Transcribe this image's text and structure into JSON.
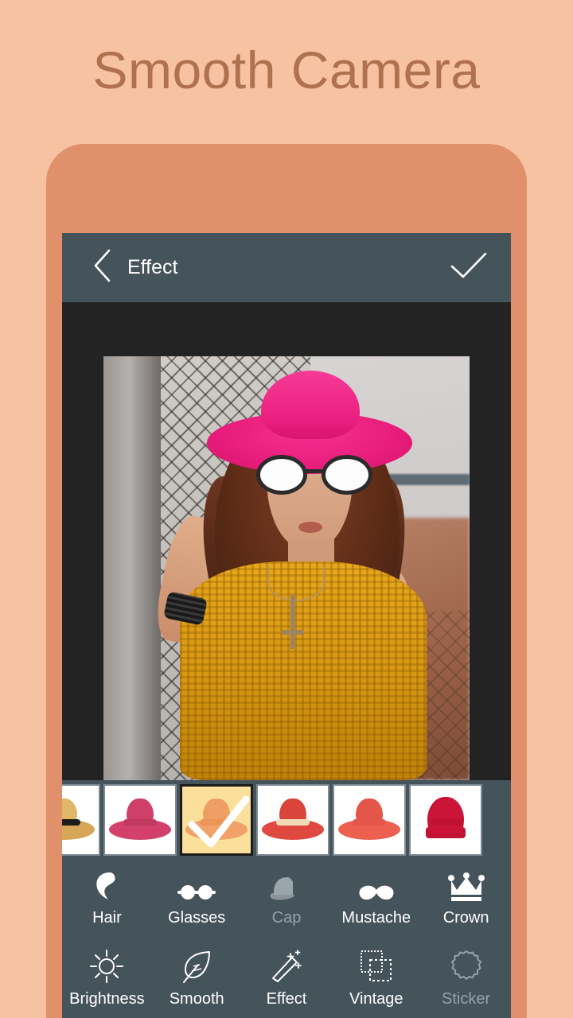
{
  "promo": {
    "title": "Smooth Camera"
  },
  "theme": {
    "background": "#f7c2a2",
    "phone_frame": "#e0916b",
    "title_color": "#b0714f",
    "bar_color": "#45535b",
    "canvas_color": "#232323",
    "selected_thumb_bg": "#fbe09b",
    "dim_text": "#98a3a9"
  },
  "appbar": {
    "back_icon": "chevron-left-icon",
    "title": "Effect",
    "done_icon": "checkmark-icon"
  },
  "photo": {
    "subject_description": "Woman in yellow knit sweater by chain-link fence",
    "overlay_hat": "pink floppy hat",
    "overlay_glasses": "white lens round glasses"
  },
  "thumbnails": [
    {
      "name": "straw-fedora",
      "selected": false,
      "brim": "#d6a758",
      "crown": "#e0b768",
      "band": "#1d1d1d"
    },
    {
      "name": "pink-bucket-hat",
      "selected": false,
      "brim": "#d3416b",
      "crown": "#cf3f68",
      "band": "#c23a61"
    },
    {
      "name": "orange-floppy-hat",
      "selected": true,
      "brim": "#f0a268",
      "crown": "#ef9f63",
      "band": "#eb9658"
    },
    {
      "name": "red-sun-hat",
      "selected": false,
      "brim": "#e0493f",
      "crown": "#d9443b",
      "band": "#f0ddb8"
    },
    {
      "name": "red-floppy-hat",
      "selected": false,
      "brim": "#ec6050",
      "crown": "#e4564a",
      "band": "#e4564a"
    },
    {
      "name": "red-beanie",
      "selected": false,
      "brim": "#c01232",
      "crown": "#ca1438",
      "band": "#c01232"
    }
  ],
  "sticker_categories": [
    {
      "label": "Hair",
      "icon": "hair-icon",
      "dim": false
    },
    {
      "label": "Glasses",
      "icon": "glasses-icon",
      "dim": false
    },
    {
      "label": "Cap",
      "icon": "cap-icon",
      "dim": true
    },
    {
      "label": "Mustache",
      "icon": "mustache-icon",
      "dim": false
    },
    {
      "label": "Crown",
      "icon": "crown-icon",
      "dim": false
    }
  ],
  "tools": [
    {
      "label": "Brightness",
      "icon": "sun-icon",
      "dim": false
    },
    {
      "label": "Smooth",
      "icon": "leaf-icon",
      "dim": false
    },
    {
      "label": "Effect",
      "icon": "magic-wand-icon",
      "dim": false
    },
    {
      "label": "Vintage",
      "icon": "frames-icon",
      "dim": false
    },
    {
      "label": "Sticker",
      "icon": "starburst-icon",
      "dim": true
    }
  ]
}
